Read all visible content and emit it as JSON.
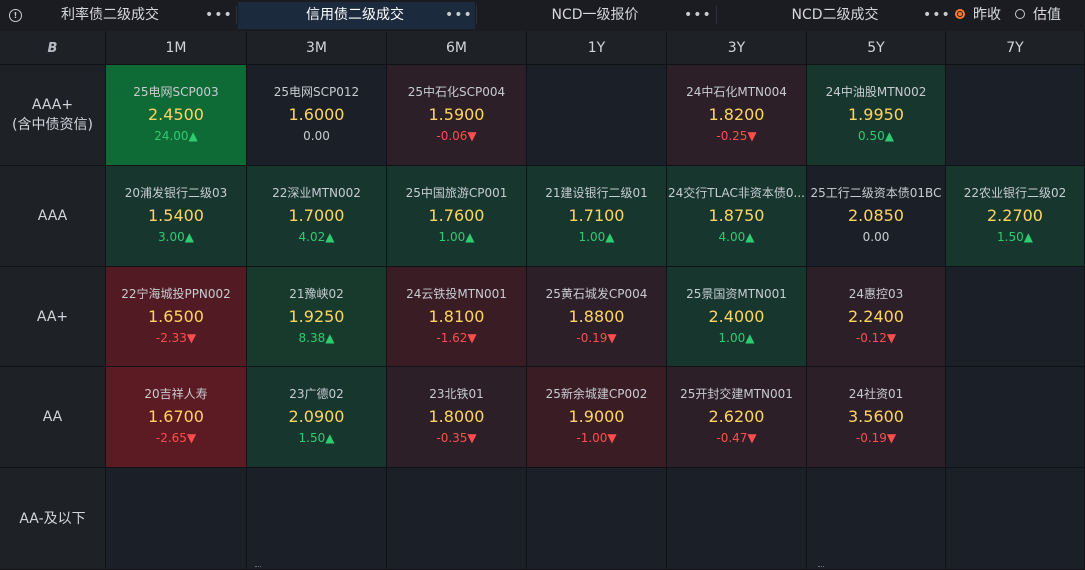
{
  "toolbar": {
    "tabs": [
      {
        "label": "利率债二级成交",
        "more": "•••",
        "active": false
      },
      {
        "label": "信用债二级成交",
        "more": "•••",
        "active": true
      },
      {
        "label": "NCD一级报价",
        "more": "•••",
        "active": false
      },
      {
        "label": "NCD二级成交",
        "more": "•••",
        "active": false
      }
    ],
    "radio": [
      {
        "label": "昨收",
        "checked": true
      },
      {
        "label": "估值",
        "checked": false
      }
    ],
    "accent_color": "#ff7a2a"
  },
  "grid": {
    "corner_icon": "B",
    "columns": [
      "1M",
      "3M",
      "6M",
      "1Y",
      "3Y",
      "5Y",
      "7Y"
    ],
    "rows": [
      {
        "label": "AAA+",
        "sublabel": "(含中债资信)",
        "cells": [
          {
            "name": "25电网SCP003",
            "price": "2.4500",
            "change": "24.00▲",
            "dir": "up",
            "tone": "c-g3"
          },
          {
            "name": "25电网SCP012",
            "price": "1.6000",
            "change": "0.00",
            "dir": "flat",
            "tone": "c-neutral"
          },
          {
            "name": "25中石化SCP004",
            "price": "1.5900",
            "change": "-0.06▼",
            "dir": "down",
            "tone": "c-r1"
          },
          null,
          {
            "name": "24中石化MTN004",
            "price": "1.8200",
            "change": "-0.25▼",
            "dir": "down",
            "tone": "c-r1"
          },
          {
            "name": "24中油股MTN002",
            "price": "1.9950",
            "change": "0.50▲",
            "dir": "up",
            "tone": "c-g1"
          },
          null
        ]
      },
      {
        "label": "AAA",
        "sublabel": "",
        "cells": [
          {
            "name": "20浦发银行二级03",
            "price": "1.5400",
            "change": "3.00▲",
            "dir": "up",
            "tone": "c-g1"
          },
          {
            "name": "22深业MTN002",
            "price": "1.7000",
            "change": "4.02▲",
            "dir": "up",
            "tone": "c-g1"
          },
          {
            "name": "25中国旅游CP001",
            "price": "1.7600",
            "change": "1.00▲",
            "dir": "up",
            "tone": "c-g1"
          },
          {
            "name": "21建设银行二级01",
            "price": "1.7100",
            "change": "1.00▲",
            "dir": "up",
            "tone": "c-g1"
          },
          {
            "name": "24交行TLAC非资本债0...",
            "price": "1.8750",
            "change": "4.00▲",
            "dir": "up",
            "tone": "c-g1"
          },
          {
            "name": "25工行二级资本债01BC",
            "price": "2.0850",
            "change": "0.00",
            "dir": "flat",
            "tone": "c-neutral"
          },
          {
            "name": "22农业银行二级02",
            "price": "2.2700",
            "change": "1.50▲",
            "dir": "up",
            "tone": "c-g1"
          }
        ]
      },
      {
        "label": "AA+",
        "sublabel": "",
        "cells": [
          {
            "name": "22宁海城投PPN002",
            "price": "1.6500",
            "change": "-2.33▼",
            "dir": "down",
            "tone": "c-r3"
          },
          {
            "name": "21豫峡02",
            "price": "1.9250",
            "change": "8.38▲",
            "dir": "up",
            "tone": "c-g2"
          },
          {
            "name": "24云铁投MTN001",
            "price": "1.8100",
            "change": "-1.62▼",
            "dir": "down",
            "tone": "c-r2"
          },
          {
            "name": "25黄石城发CP004",
            "price": "1.8800",
            "change": "-0.19▼",
            "dir": "down",
            "tone": "c-r1"
          },
          {
            "name": "25景国资MTN001",
            "price": "2.4000",
            "change": "1.00▲",
            "dir": "up",
            "tone": "c-g1"
          },
          {
            "name": "24惠控03",
            "price": "2.2400",
            "change": "-0.12▼",
            "dir": "down",
            "tone": "c-r1"
          },
          null
        ]
      },
      {
        "label": "AA",
        "sublabel": "",
        "cells": [
          {
            "name": "20吉祥人寿",
            "price": "1.6700",
            "change": "-2.65▼",
            "dir": "down",
            "tone": "c-r4"
          },
          {
            "name": "23广德02",
            "price": "2.0900",
            "change": "1.50▲",
            "dir": "up",
            "tone": "c-g1"
          },
          {
            "name": "23北铁01",
            "price": "1.8000",
            "change": "-0.35▼",
            "dir": "down",
            "tone": "c-r1"
          },
          {
            "name": "25新余城建CP002",
            "price": "1.9000",
            "change": "-1.00▼",
            "dir": "down",
            "tone": "c-r2"
          },
          {
            "name": "25开封交建MTN001",
            "price": "2.6200",
            "change": "-0.47▼",
            "dir": "down",
            "tone": "c-r1"
          },
          {
            "name": "24社资01",
            "price": "3.5600",
            "change": "-0.19▼",
            "dir": "down",
            "tone": "c-r1"
          },
          null
        ]
      },
      {
        "label": "AA-及以下",
        "sublabel": "",
        "cells": [
          null,
          null,
          null,
          null,
          null,
          null,
          null
        ]
      }
    ]
  }
}
